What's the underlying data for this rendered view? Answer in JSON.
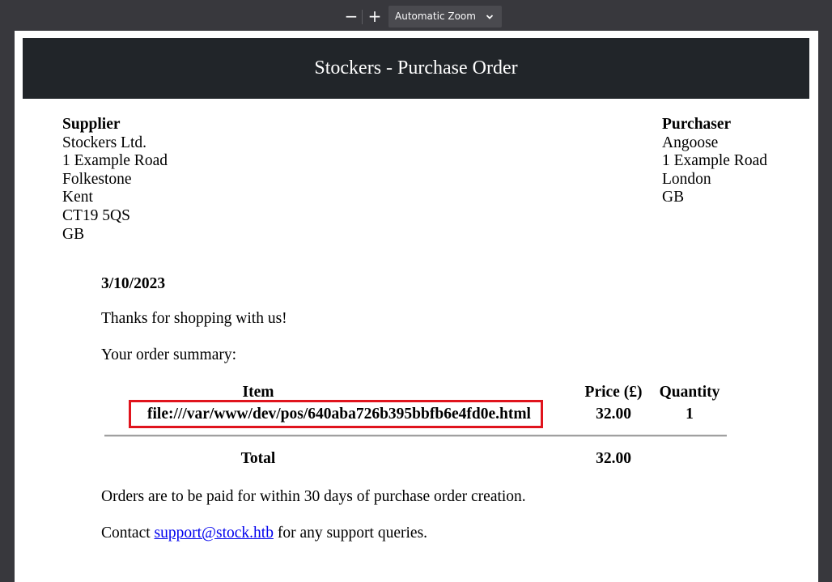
{
  "toolbar": {
    "zoom_out_label": "−",
    "zoom_in_label": "+",
    "zoom_label": "Automatic Zoom"
  },
  "document": {
    "title": "Stockers - Purchase Order",
    "supplier": {
      "heading": "Supplier",
      "lines": [
        "Stockers Ltd.",
        "1 Example Road",
        "Folkestone",
        "Kent",
        "CT19 5QS",
        "GB"
      ]
    },
    "purchaser": {
      "heading": "Purchaser",
      "lines": [
        "Angoose",
        "1 Example Road",
        "London",
        "GB"
      ]
    },
    "date": "3/10/2023",
    "thanks": "Thanks for shopping with us!",
    "summary_label": "Your order summary:",
    "table": {
      "headers": {
        "item": "Item",
        "price": "Price (£)",
        "quantity": "Quantity"
      },
      "rows": [
        {
          "item": "file:///var/www/dev/pos/640aba726b395bbfb6e4fd0e.html",
          "price": "32.00",
          "quantity": "1"
        }
      ],
      "total_label": "Total",
      "total_value": "32.00"
    },
    "payment_terms": "Orders are to be paid for within 30 days of purchase order creation.",
    "contact": {
      "prefix": "Contact ",
      "email": "support@stock.htb",
      "suffix": " for any support queries."
    }
  },
  "colors": {
    "banner_bg": "#212529",
    "highlight_border": "#e0141d",
    "link": "#0000ee"
  }
}
